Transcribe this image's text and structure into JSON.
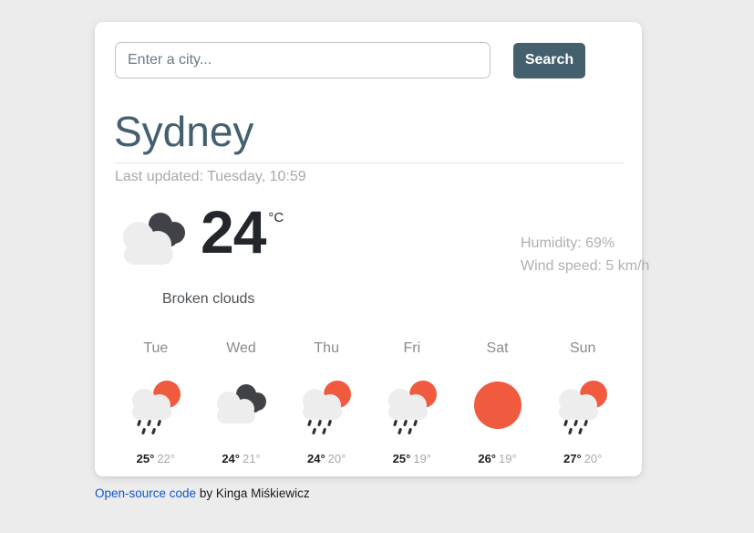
{
  "search": {
    "placeholder": "Enter a city...",
    "value": "",
    "button_label": "Search"
  },
  "current": {
    "city": "Sydney",
    "last_updated": "Last updated: Tuesday, 10:59",
    "temperature": "24",
    "unit": "°C",
    "description": "Broken clouds",
    "icon": "broken-clouds-icon",
    "humidity": "Humidity: 69%",
    "wind": "Wind speed: 5 km/h"
  },
  "forecast": [
    {
      "day": "Tue",
      "icon": "rain-sun-icon",
      "max": "25°",
      "min": "22°"
    },
    {
      "day": "Wed",
      "icon": "broken-clouds-icon",
      "max": "24°",
      "min": "21°"
    },
    {
      "day": "Thu",
      "icon": "rain-sun-icon",
      "max": "24°",
      "min": "20°"
    },
    {
      "day": "Fri",
      "icon": "rain-sun-icon",
      "max": "25°",
      "min": "19°"
    },
    {
      "day": "Sat",
      "icon": "sun-icon",
      "max": "26°",
      "min": "19°"
    },
    {
      "day": "Sun",
      "icon": "rain-sun-icon",
      "max": "27°",
      "min": "20°"
    }
  ],
  "footer": {
    "link_text": "Open-source code",
    "rest_text": " by Kinga Miśkiewicz"
  },
  "colors": {
    "accent_sun": "#f05a3f",
    "cloud_light": "#ededed",
    "cloud_dark": "#404247",
    "button": "#44606e",
    "heading": "#44606e",
    "link": "#1155cc"
  }
}
